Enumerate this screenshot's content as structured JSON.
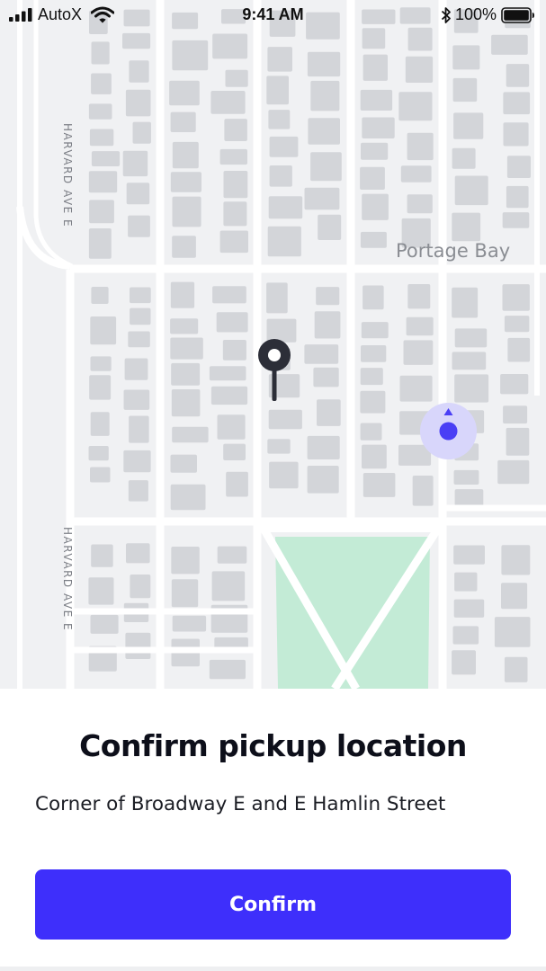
{
  "status_bar": {
    "carrier": "AutoX",
    "time": "9:41 AM",
    "battery": "100%",
    "icons": [
      "signal-icon",
      "wifi-icon",
      "bluetooth-icon",
      "battery-icon"
    ]
  },
  "map": {
    "street_labels": [
      "HARVARD AVE E",
      "HARVARD AVE E"
    ],
    "area_label": "Portage Bay",
    "markers": [
      "pickup-pin-icon",
      "current-location-icon"
    ],
    "colors": {
      "background": "#f0f1f3",
      "road": "#ffffff",
      "building": "#d3d5d9",
      "park": "#c3ebd6",
      "pin": "#2c2e38",
      "location_dot": "#4a3ff5",
      "location_halo": "#d8d6fb"
    }
  },
  "sheet": {
    "title": "Confirm pickup location",
    "address": "Corner of Broadway E and E Hamlin Street",
    "confirm_label": "Confirm",
    "colors": {
      "button": "#3e2ffb",
      "button_text": "#ffffff"
    }
  }
}
